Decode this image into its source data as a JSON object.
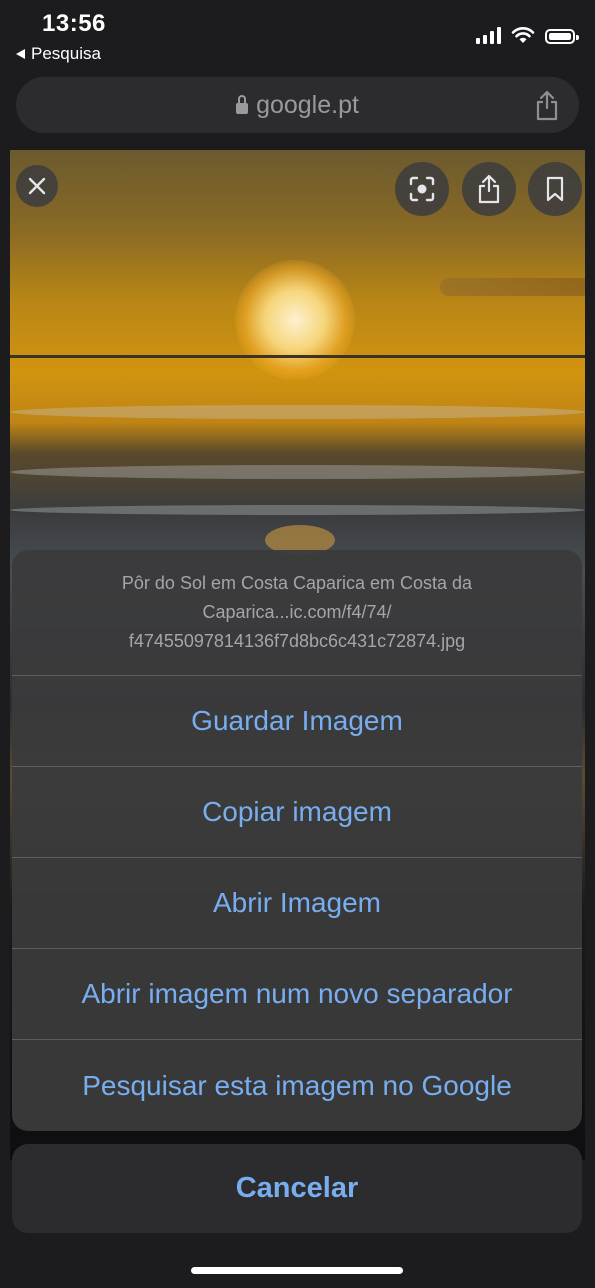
{
  "status_bar": {
    "time": "13:56",
    "back_label": "Pesquisa"
  },
  "address_bar": {
    "url": "google.pt"
  },
  "image_viewer": {
    "icons": [
      "close-icon",
      "lens-icon",
      "share-icon",
      "bookmark-icon"
    ]
  },
  "action_sheet": {
    "title": "Pôr do Sol em Costa Caparica em Costa da Caparica...ic.com/f4/74/ f47455097814136f7d8bc6c431c72874.jpg",
    "actions": [
      {
        "label": "Guardar Imagem"
      },
      {
        "label": "Copiar imagem"
      },
      {
        "label": "Abrir Imagem"
      },
      {
        "label": "Abrir imagem num novo separador"
      },
      {
        "label": "Pesquisar esta imagem no Google"
      }
    ],
    "cancel_label": "Cancelar"
  },
  "colors": {
    "action_text": "#78aef0",
    "sheet_bg": "#3a3a3c",
    "background": "#1c1c1e"
  }
}
